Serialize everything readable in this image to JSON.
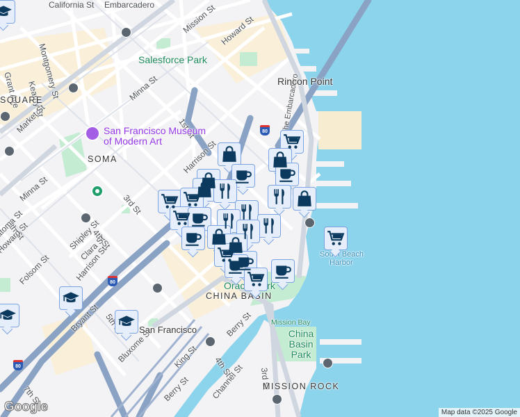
{
  "map": {
    "streets": [
      "California St",
      "Embarcadero",
      "Mission St",
      "Howard St",
      "Montgomery St",
      "Grant Ave",
      "Kearny St",
      "Minna St",
      "1st St",
      "Market St",
      "Harrison St",
      "3rd St",
      "Minna St",
      "5th St",
      "Natoma St",
      "Howard St",
      "Shipley St",
      "4th St",
      "Clara St",
      "Harrison St",
      "Folsom St",
      "Bryant St",
      "5th St",
      "Bluxome St",
      "King St",
      "4th St",
      "Berry St",
      "Berry St",
      "Channel St",
      "3rd St",
      "7th St",
      "The Embarcadero"
    ],
    "areas": [
      "SQUARE",
      "SOMA",
      "CHINA BASIN",
      "MISSION ROCK"
    ],
    "parks": [
      "Salesforce Park",
      "Oracle Park",
      "Mission Bay",
      "China Basin Park"
    ],
    "pois": [
      "San Francisco Museum",
      "of Modern Art",
      "San Francisco"
    ],
    "places": [
      "Rincon Point",
      "South Beach",
      "Harbor"
    ],
    "highway": "80",
    "markers": [
      "cart-icon",
      "bag-icon",
      "cup-icon",
      "fork-knife-icon",
      "graduation-cap-icon"
    ]
  },
  "footer": {
    "logo": "Google",
    "attribution": "Map data ©2025 Google"
  },
  "colors": {
    "water": "#8cd3ec",
    "land": "#f3f2f4",
    "marker": "#0b3a5e",
    "park": "#c4ecd2",
    "highway": "#8aa2c4"
  }
}
